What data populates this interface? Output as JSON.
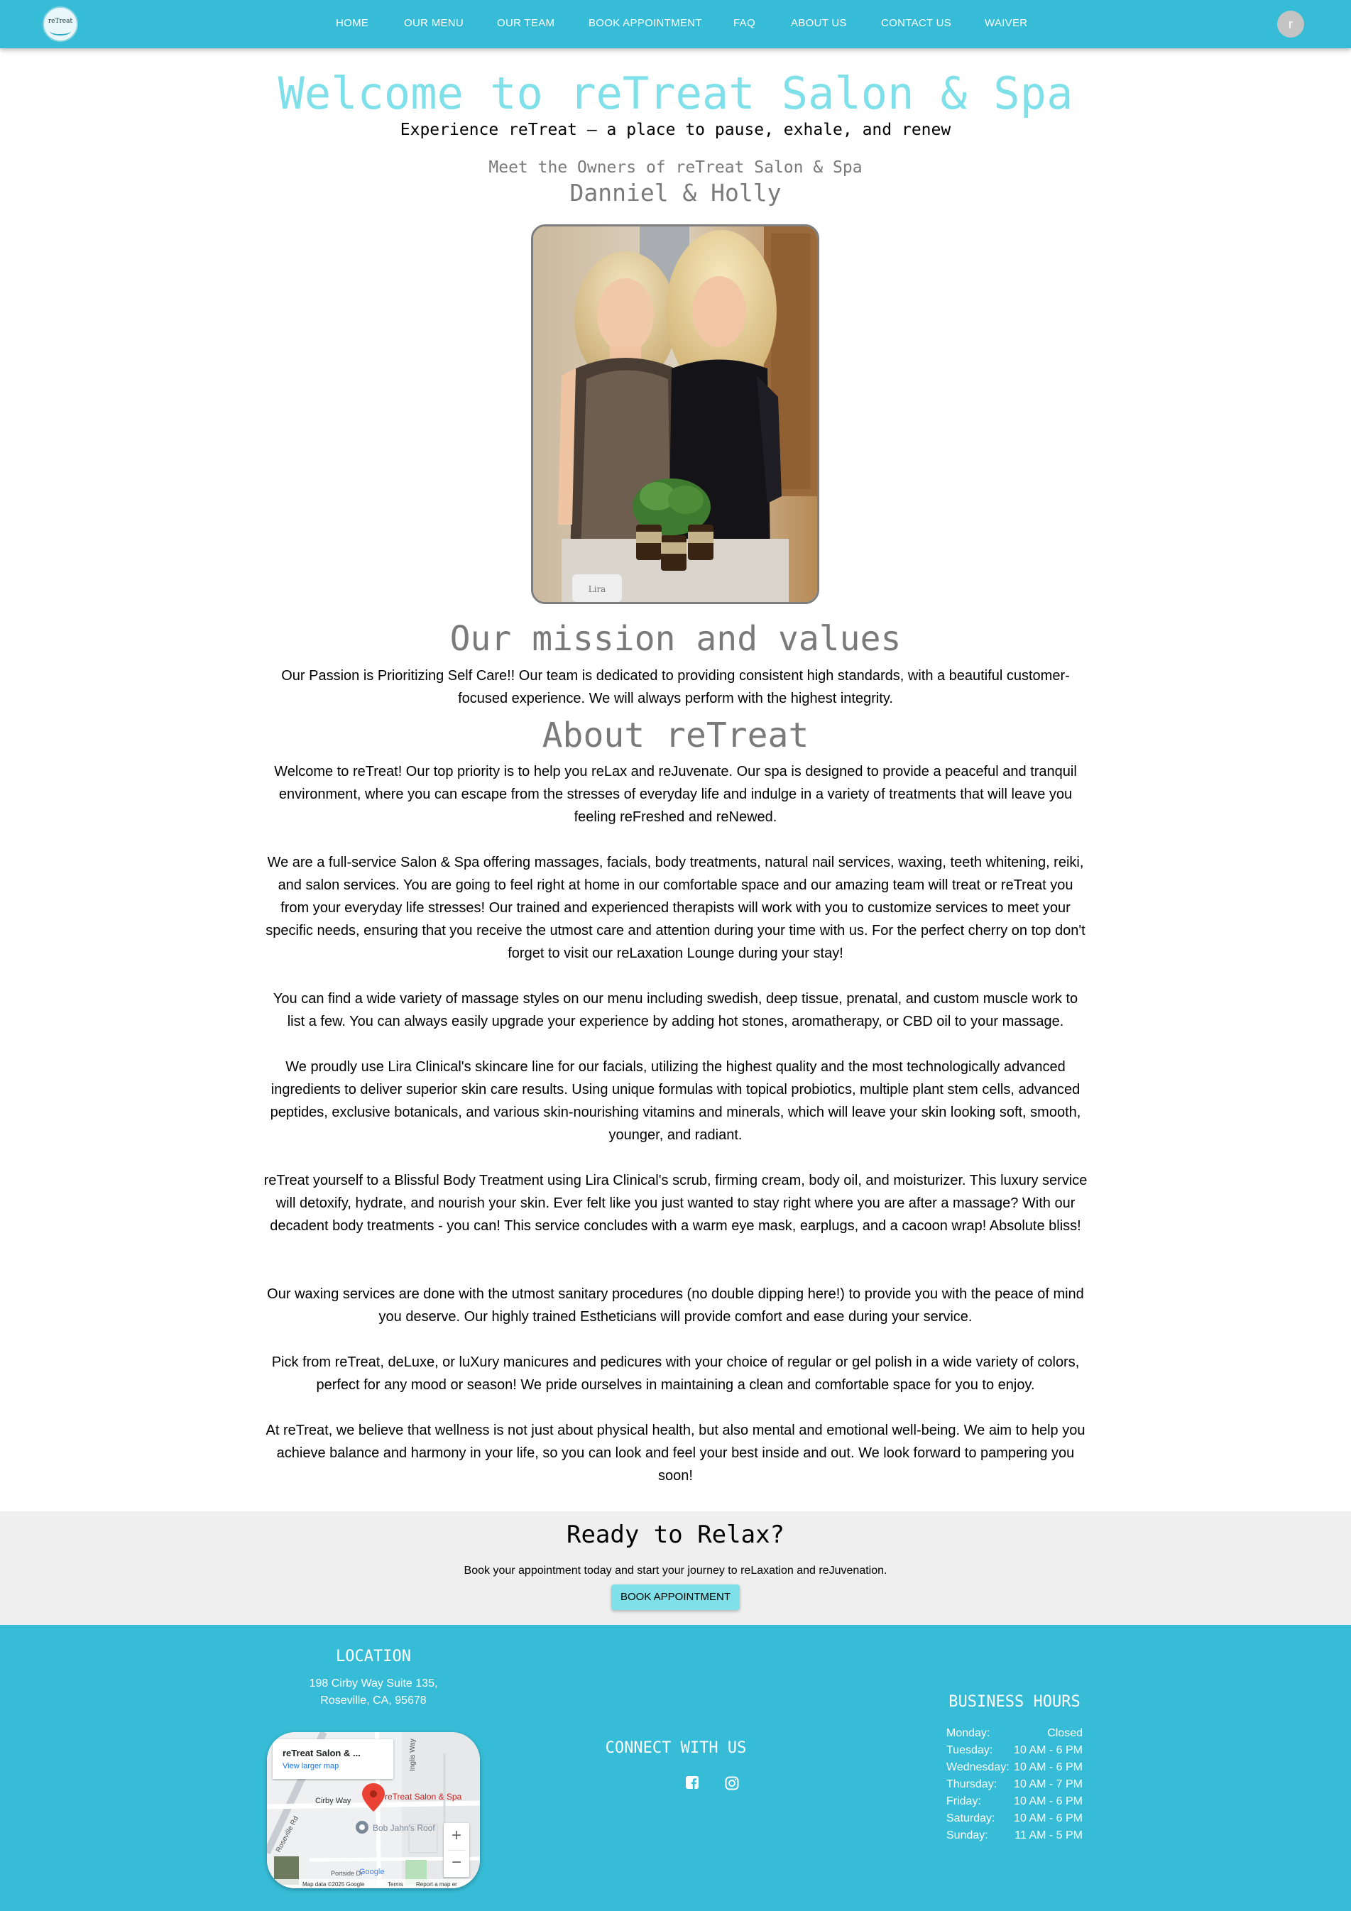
{
  "colors": {
    "header": "#36bcd6",
    "accent": "#7fe0e9",
    "heading_gray": "#7a7a7a",
    "band": "#efefef"
  },
  "header": {
    "logo_text": "reTreat",
    "nav": [
      {
        "label": "HOME"
      },
      {
        "label": "OUR MENU"
      },
      {
        "label": "OUR TEAM"
      },
      {
        "label": "BOOK APPOINTMENT"
      },
      {
        "label": "FAQ"
      },
      {
        "label": "ABOUT US"
      },
      {
        "label": "CONTACT US"
      },
      {
        "label": "WAIVER"
      }
    ],
    "avatar_letter": "r"
  },
  "hero": {
    "title": "Welcome to reTreat Salon & Spa",
    "tagline": "Experience reTreat — a place to pause, exhale, and renew",
    "meet": "Meet the Owners of reTreat Salon & Spa",
    "owners": "Danniel & Holly",
    "photo_sign": "Lira"
  },
  "mission": {
    "title": "Our mission and values",
    "text": "Our Passion is Prioritizing Self Care!! Our team is dedicated to providing consistent high standards, with a beautiful customer-focused experience. We will always perform with the highest integrity."
  },
  "about": {
    "title": "About reTreat",
    "paragraphs": [
      "Welcome to reTreat! Our top priority is to help you reLax and reJuvenate. Our spa is designed to provide a peaceful and tranquil environment, where you can escape from the stresses of everyday life and indulge in a variety of treatments that will leave you feeling reFreshed and reNewed.",
      "We are a full-service Salon & Spa offering massages, facials, body treatments, natural nail services, waxing, teeth whitening, reiki, and salon services. You are going to feel right at home in our comfortable space and our amazing team will treat or reTreat you from your everyday life stresses! Our trained and experienced therapists will work with you to customize services to meet your specific needs, ensuring that you receive the utmost care and attention during your time with us. For the perfect cherry on top don't forget to visit our reLaxation Lounge during your stay!",
      "You can find a wide variety of massage styles on our menu including swedish, deep tissue, prenatal, and custom muscle work to list a few. You can always easily upgrade your experience by adding hot stones, aromatherapy, or CBD oil to your massage.",
      "We proudly use Lira Clinical's skincare line for our facials, utilizing the highest quality and the most technologically advanced ingredients to deliver superior skin care results. Using unique formulas with topical probiotics, multiple plant stem cells, advanced peptides, exclusive botanicals, and various skin-nourishing vitamins and minerals, which will leave your skin looking soft, smooth, younger, and radiant.",
      "reTreat yourself to a Blissful Body Treatment using Lira Clinical's scrub, firming cream, body oil, and moisturizer. This luxury service will detoxify, hydrate, and nourish your skin. Ever felt like you just wanted to stay right where you are after a massage? With our decadent body treatments - you can! This service concludes with a warm eye mask, earplugs, and a cacoon wrap! Absolute bliss!",
      "Our waxing services are done with the utmost sanitary procedures (no double dipping here!) to provide you with the peace of mind you deserve. Our highly trained Estheticians will provide comfort and ease during your service.",
      "Pick from reTreat, deLuxe, or luXury manicures and pedicures with your choice of regular or gel polish in a wide variety of colors, perfect for any mood or season! We pride ourselves in maintaining a clean and comfortable space for you to enjoy.",
      "At reTreat, we believe that wellness is not just about physical health, but also mental and emotional well-being. We aim to help you achieve balance and harmony in your life, so you can look and feel your best inside and out. We look forward to pampering you soon!"
    ]
  },
  "cta": {
    "title": "Ready to Relax?",
    "text": "Book your appointment today and start your journey to reLaxation and reJuvenation.",
    "button": "BOOK APPOINTMENT"
  },
  "footer": {
    "location_title": "LOCATION",
    "address1": "198 Cirby Way Suite 135,",
    "address2": "Roseville, CA, 95678",
    "map": {
      "place": "reTreat Salon & ...",
      "link": "View larger map",
      "pin_label": "reTreat Salon & Spa",
      "poi": "Bob Jahn's Roof",
      "streets": [
        "Cirby Way",
        "Inglis Way",
        "Roseville Rd",
        "Portside Dr"
      ],
      "attribution": "Map data ©2025 Google",
      "terms": "Terms",
      "report": "Report a map er",
      "google": "Google",
      "zoom_in": "+",
      "zoom_out": "−"
    },
    "connect_title": "CONNECT WITH US",
    "hours_title": "BUSINESS HOURS",
    "hours": [
      {
        "day": "Monday:",
        "time": "Closed"
      },
      {
        "day": "Tuesday:",
        "time": "10 AM - 6 PM"
      },
      {
        "day": "Wednesday:",
        "time": "10 AM - 6 PM"
      },
      {
        "day": "Thursday:",
        "time": "10 AM - 7 PM"
      },
      {
        "day": "Friday:",
        "time": "10 AM - 6 PM"
      },
      {
        "day": "Saturday:",
        "time": "10 AM - 6 PM"
      },
      {
        "day": "Sunday:",
        "time": "11 AM - 5 PM"
      }
    ]
  }
}
